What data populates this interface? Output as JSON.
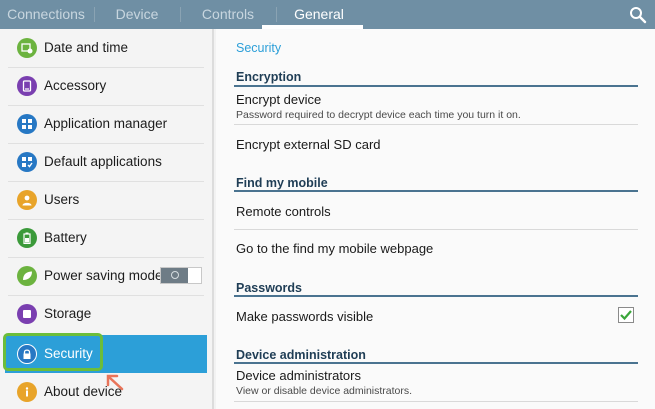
{
  "tabs": [
    {
      "label": "Connections",
      "active": false
    },
    {
      "label": "Device",
      "active": false
    },
    {
      "label": "Controls",
      "active": false
    },
    {
      "label": "General",
      "active": true
    }
  ],
  "sidebar": {
    "items": [
      {
        "label": "Date and time",
        "icon": "calendar-clock-icon",
        "color": "#6cb33f"
      },
      {
        "label": "Accessory",
        "icon": "accessory-device-icon",
        "color": "#7a3fb0"
      },
      {
        "label": "Application manager",
        "icon": "grid-apps-icon",
        "color": "#2778c4"
      },
      {
        "label": "Default applications",
        "icon": "default-apps-icon",
        "color": "#2778c4"
      },
      {
        "label": "Users",
        "icon": "user-icon",
        "color": "#e8a42a"
      },
      {
        "label": "Battery",
        "icon": "battery-icon",
        "color": "#3b9a3a"
      },
      {
        "label": "Power saving mode",
        "icon": "leaf-icon",
        "color": "#6cb33f",
        "toggle": "off"
      },
      {
        "label": "Storage",
        "icon": "storage-icon",
        "color": "#7a3fb0"
      },
      {
        "label": "Security",
        "icon": "lock-icon",
        "color": "#2778c4",
        "selected": true
      },
      {
        "label": "About device",
        "icon": "info-icon",
        "color": "#e8a42a"
      }
    ]
  },
  "main": {
    "title": "Security",
    "sections": {
      "encryption": "Encryption",
      "find_my_mobile": "Find my mobile",
      "passwords": "Passwords",
      "device_admin": "Device administration"
    },
    "rows": {
      "encrypt_device": {
        "title": "Encrypt device",
        "subtitle": "Password required to decrypt device each time you turn it on."
      },
      "encrypt_sd": {
        "title": "Encrypt external SD card"
      },
      "remote_controls": {
        "title": "Remote controls"
      },
      "find_webpage": {
        "title": "Go to the find my mobile webpage"
      },
      "make_visible": {
        "title": "Make passwords visible",
        "checked": true
      },
      "device_admins": {
        "title": "Device administrators",
        "subtitle": "View or disable device administrators."
      }
    }
  },
  "colors": {
    "topbar": "#6f8fa4",
    "accent": "#2c9fd8",
    "highlight_frame": "#6cbd3a",
    "pointer_arrow": "#e8745a",
    "check": "#3aa63a"
  }
}
